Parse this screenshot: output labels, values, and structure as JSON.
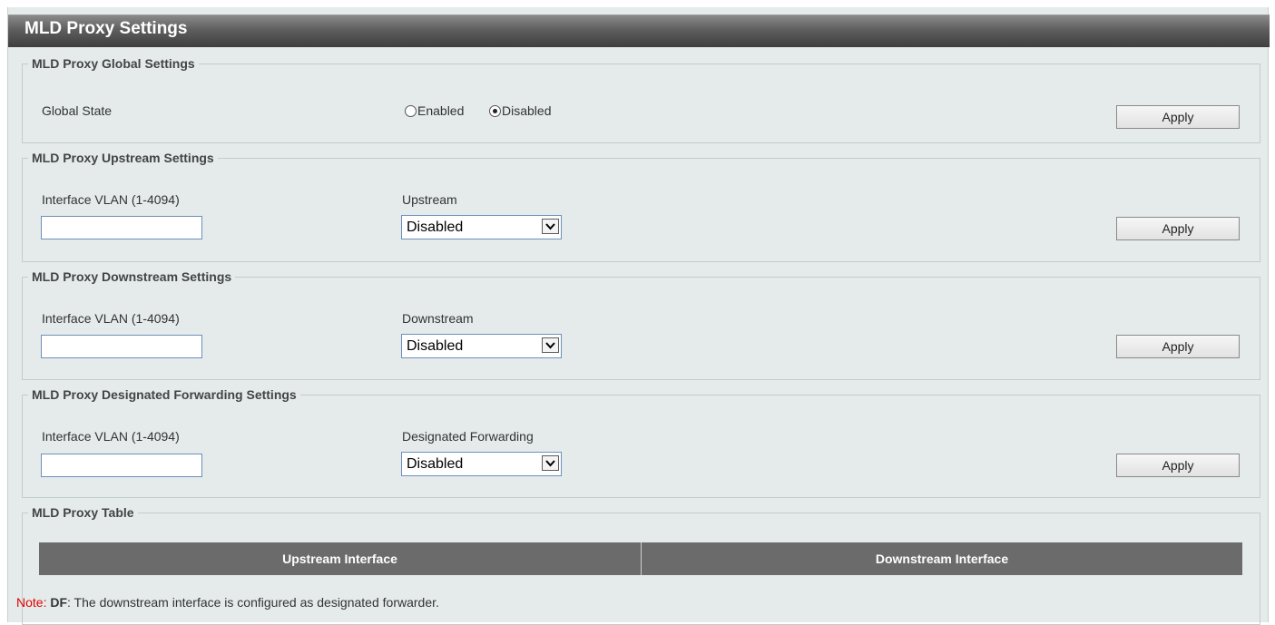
{
  "page_title": "MLD Proxy Settings",
  "global_settings": {
    "legend": "MLD Proxy Global Settings",
    "state_label": "Global State",
    "options": [
      "Enabled",
      "Disabled"
    ],
    "selected": "Disabled",
    "apply_label": "Apply"
  },
  "upstream_settings": {
    "legend": "MLD Proxy Upstream Settings",
    "vlan_label": "Interface VLAN (1-4094)",
    "vlan_value": "",
    "select_label": "Upstream",
    "select_value": "Disabled",
    "apply_label": "Apply"
  },
  "downstream_settings": {
    "legend": "MLD Proxy Downstream Settings",
    "vlan_label": "Interface VLAN (1-4094)",
    "vlan_value": "",
    "select_label": "Downstream",
    "select_value": "Disabled",
    "apply_label": "Apply"
  },
  "df_settings": {
    "legend": "MLD Proxy Designated Forwarding Settings",
    "vlan_label": "Interface VLAN (1-4094)",
    "vlan_value": "",
    "select_label": "Designated Forwarding",
    "select_value": "Disabled",
    "apply_label": "Apply"
  },
  "proxy_table": {
    "legend": "MLD Proxy Table",
    "columns": [
      "Upstream Interface",
      "Downstream Interface"
    ]
  },
  "note": {
    "tag": "Note:",
    "term": "DF",
    "text": ": The downstream interface is configured as designated forwarder."
  },
  "colors": {
    "panel_bg": "#e4ebea",
    "title_bar": "#4a4a4a",
    "table_header": "#6b6b6b",
    "note_tag": "#e00000",
    "input_border": "#6e8fbd"
  }
}
